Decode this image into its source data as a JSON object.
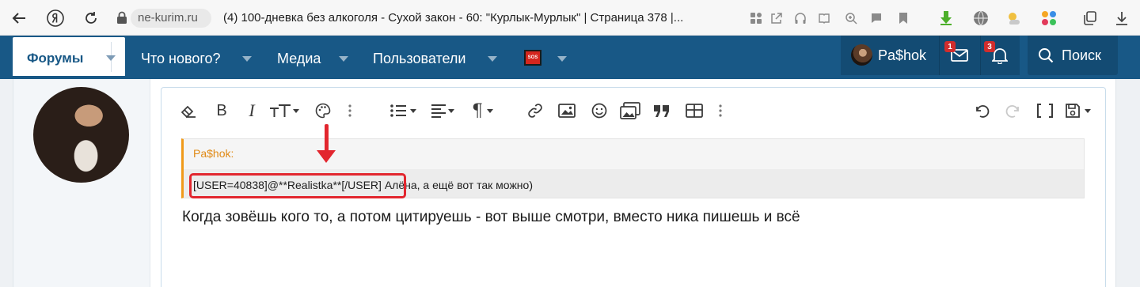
{
  "browser": {
    "host": "ne-kurim.ru",
    "tab_title": "(4) 100-дневка без алкоголя - Сухой закон - 60: \"Курлык-Мурлык\" | Страница 378 |..."
  },
  "nav": {
    "forums_label": "Форумы",
    "whats_new_label": "Что нового?",
    "media_label": "Медиа",
    "users_label": "Пользователи",
    "sos_label": "SOS",
    "username": "Pa$hok",
    "messages_badge": "1",
    "alerts_badge": "3",
    "search_label": "Поиск"
  },
  "editor": {
    "quote_author": "Pa$hok:",
    "quote_text": "[USER=40838]@**Realistka**[/USER] Алёна, а ещё вот так можно)",
    "body_text": "Когда зовёшь кого то, а потом цитируешь - вот выше смотри, вместо ника пишешь и всё"
  },
  "colors": {
    "nav_bg": "#185886",
    "nav_dark": "#134b73",
    "badge": "#d12d2d",
    "quote_accent": "#f09a1a",
    "annotation_red": "#e2262e"
  }
}
